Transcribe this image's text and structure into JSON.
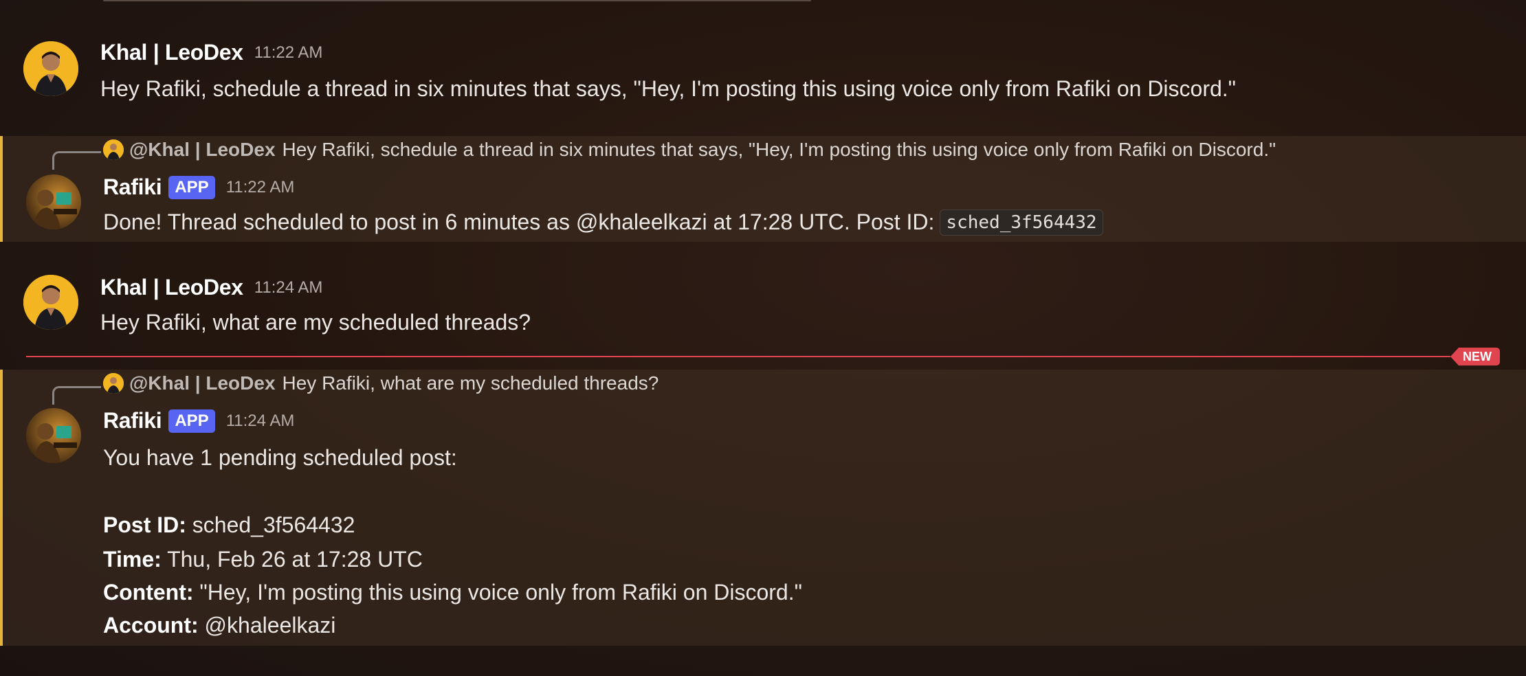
{
  "messages": [
    {
      "author": "Khal | LeoDex",
      "time": "11:22 AM",
      "text": "Hey Rafiki, schedule a thread in six minutes that says, \"Hey, I'm posting this using voice only from Rafiki on Discord.\""
    },
    {
      "reply_to": {
        "mention": "@Khal | LeoDex",
        "text": "Hey Rafiki, schedule a thread in six minutes that says, \"Hey, I'm posting this using voice only from Rafiki on Discord.\""
      },
      "author": "Rafiki",
      "badge": "APP",
      "time": "11:22 AM",
      "text": "Done! Thread scheduled to post in 6 minutes as @khaleelkazi at 17:28 UTC. Post ID:",
      "code": "sched_3f564432"
    },
    {
      "author": "Khal | LeoDex",
      "time": "11:24 AM",
      "text": "Hey Rafiki, what are my scheduled threads?"
    },
    {
      "reply_to": {
        "mention": "@Khal | LeoDex",
        "text": "Hey Rafiki, what are my scheduled threads?"
      },
      "author": "Rafiki",
      "badge": "APP",
      "time": "11:24 AM",
      "intro": "You have 1 pending scheduled post:",
      "details": [
        {
          "label": "Post ID:",
          "value": "sched_3f564432"
        },
        {
          "label": "Time:",
          "value": "Thu, Feb 26 at 17:28 UTC"
        },
        {
          "label": "Content:",
          "value": "\"Hey, I'm posting this using voice only from Rafiki on Discord.\""
        },
        {
          "label": "Account:",
          "value": "@khaleelkazi"
        }
      ]
    }
  ],
  "divider": {
    "label": "NEW"
  },
  "colors": {
    "mention_bar": "#e6b43a",
    "app_badge": "#5865f2",
    "new_divider": "#e0444f"
  }
}
